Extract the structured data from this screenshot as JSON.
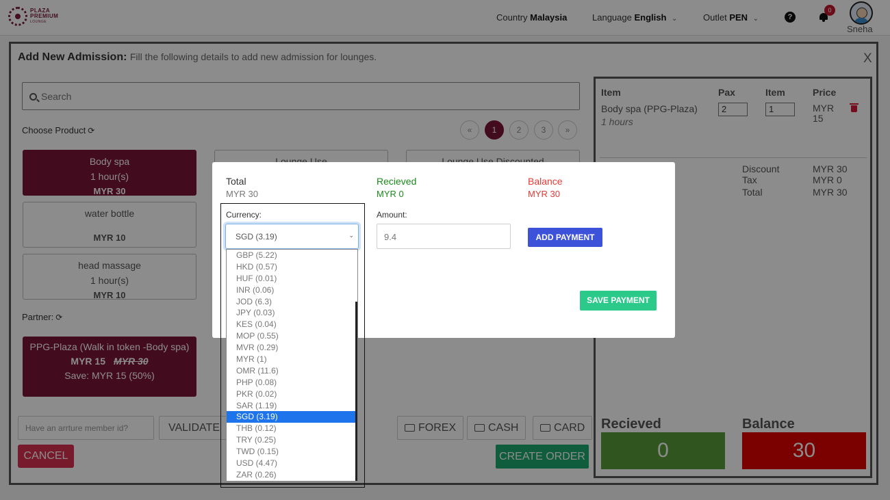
{
  "header": {
    "logo": {
      "line1": "PLAZA",
      "line2": "PREMIUM",
      "line3": "LOUNGE"
    },
    "country_label": "Country",
    "country_value": "Malaysia",
    "language_label": "Language",
    "language_value": "English",
    "outlet_label": "Outlet",
    "outlet_value": "PEN",
    "notifications_count": "0",
    "user_name": "Sneha",
    "icons": {
      "help": "question-circle-icon",
      "notifications": "bell-icon",
      "avatar": "user-avatar"
    }
  },
  "admission": {
    "title": "Add New Admission:",
    "subtitle": "Fill the following details to add new admission for lounges.",
    "close_label": "X",
    "search_placeholder": "Search",
    "choose_product_label": "Choose Product",
    "pages": [
      "«",
      "1",
      "2",
      "3",
      "»"
    ],
    "active_page": "1",
    "products": [
      {
        "name": "Body spa",
        "duration": "1 hour(s)",
        "price": "MYR 30",
        "selected": true
      },
      {
        "name": "Lounge Use",
        "duration": "",
        "price": "",
        "selected": false
      },
      {
        "name": "Lounge Use Discounted",
        "duration": "",
        "price": "",
        "selected": false
      },
      {
        "name": "water bottle",
        "duration": "",
        "price": "MYR 10",
        "selected": false
      },
      {
        "name": "head massage",
        "duration": "1 hour(s)",
        "price": "MYR 10",
        "selected": false
      }
    ],
    "partner_label": "Partner:",
    "partner": {
      "name": "PPG-Plaza (Walk in token -Body spa)",
      "price": "MYR 15",
      "original_price": "MYR 30",
      "save": "Save: MYR 15 (50%)"
    },
    "member_placeholder": "Have an arrture member id?",
    "validate_label": "VALIDATE",
    "cancel_label": "CANCEL",
    "payment_methods": [
      "FOREX",
      "CASH",
      "CARD"
    ],
    "create_order_label": "CREATE ORDER"
  },
  "cart": {
    "headers": {
      "item": "Item",
      "pax": "Pax",
      "item_qty": "Item",
      "price": "Price"
    },
    "line": {
      "name": "Body spa (PPG-Plaza)",
      "duration": "1 hours",
      "pax": "2",
      "qty": "1",
      "price": "MYR 15"
    },
    "summary": [
      {
        "label": "Discount",
        "value": "MYR 30"
      },
      {
        "label": "Tax",
        "value": "MYR 0"
      },
      {
        "label": "Total",
        "value": "MYR 30"
      }
    ],
    "received_label": "Recieved",
    "received_value": "0",
    "balance_label": "Balance",
    "balance_value": "30",
    "colors": {
      "received": "#5a9b3a",
      "balance": "#e00000"
    }
  },
  "payment_modal": {
    "total_label": "Total",
    "total_value": "MYR 30",
    "received_label": "Recieved",
    "received_value": "MYR 0",
    "balance_label": "Balance",
    "balance_value": "MYR 30",
    "currency_label": "Currency:",
    "currency_selected": "SGD (3.19)",
    "amount_label": "Amount:",
    "amount_value": "9.4",
    "add_payment_label": "ADD PAYMENT",
    "save_payment_label": "SAVE PAYMENT",
    "colors": {
      "received": "#1a8a1a",
      "balance": "#e53935"
    }
  },
  "currency_options": [
    "GBP (5.22)",
    "HKD (0.57)",
    "HUF (0.01)",
    "INR (0.06)",
    "JOD (6.3)",
    "JPY (0.03)",
    "KES (0.04)",
    "MOP (0.55)",
    "MVR (0.29)",
    "MYR (1)",
    "OMR (11.6)",
    "PHP (0.08)",
    "PKR (0.02)",
    "SAR (1.19)",
    "SGD (3.19)",
    "THB (0.12)",
    "TRY (0.25)",
    "TWD (0.15)",
    "USD (4.47)",
    "ZAR (0.26)"
  ],
  "currency_selected_index": 14
}
